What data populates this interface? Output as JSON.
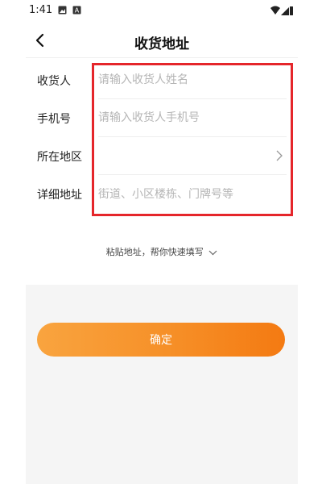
{
  "status_bar": {
    "time": "1:41",
    "icons": [
      "image-icon",
      "notification-icon",
      "wifi-icon",
      "signal-icon",
      "battery-icon"
    ]
  },
  "header": {
    "title": "收货地址",
    "back_icon": "chevron-left-icon"
  },
  "form": {
    "recipient": {
      "label": "收货人",
      "placeholder": "请输入收货人姓名",
      "value": ""
    },
    "phone": {
      "label": "手机号",
      "placeholder": "请输入收货人手机号",
      "value": ""
    },
    "region": {
      "label": "所在地区",
      "value": "",
      "icon": "chevron-right-icon"
    },
    "detail": {
      "label": "详细地址",
      "placeholder": "街道、小区楼栋、门牌号等",
      "value": ""
    }
  },
  "paste_hint": {
    "text": "粘贴地址，帮你快速填写",
    "icon": "chevron-down-icon"
  },
  "confirm_button": {
    "label": "确定"
  },
  "colors": {
    "accent_start": "#f9a43f",
    "accent_end": "#f47a12",
    "highlight": "#e5262b",
    "placeholder": "#b5b5b5",
    "bottom_bg": "#f5f5f5"
  }
}
